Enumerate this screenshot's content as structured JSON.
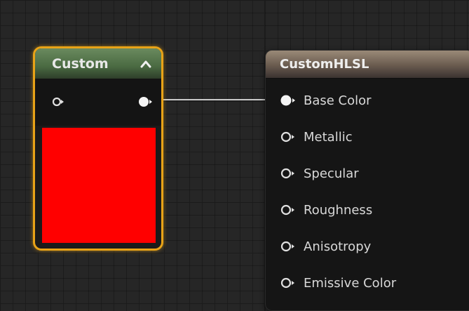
{
  "custom_node": {
    "title": "Custom",
    "preview_color": "#ff0000",
    "border_color": "#e8a317"
  },
  "hlsl_node": {
    "title": "CustomHLSL",
    "inputs": [
      {
        "label": "Base Color",
        "connected": true
      },
      {
        "label": "Metallic",
        "connected": false
      },
      {
        "label": "Specular",
        "connected": false
      },
      {
        "label": "Roughness",
        "connected": false
      },
      {
        "label": "Anisotropy",
        "connected": false
      },
      {
        "label": "Emissive Color",
        "connected": false
      }
    ]
  },
  "icons": {
    "collapse": "chevron-up-icon",
    "input_pin": "pin-outline-icon",
    "output_pin": "pin-filled-icon"
  }
}
